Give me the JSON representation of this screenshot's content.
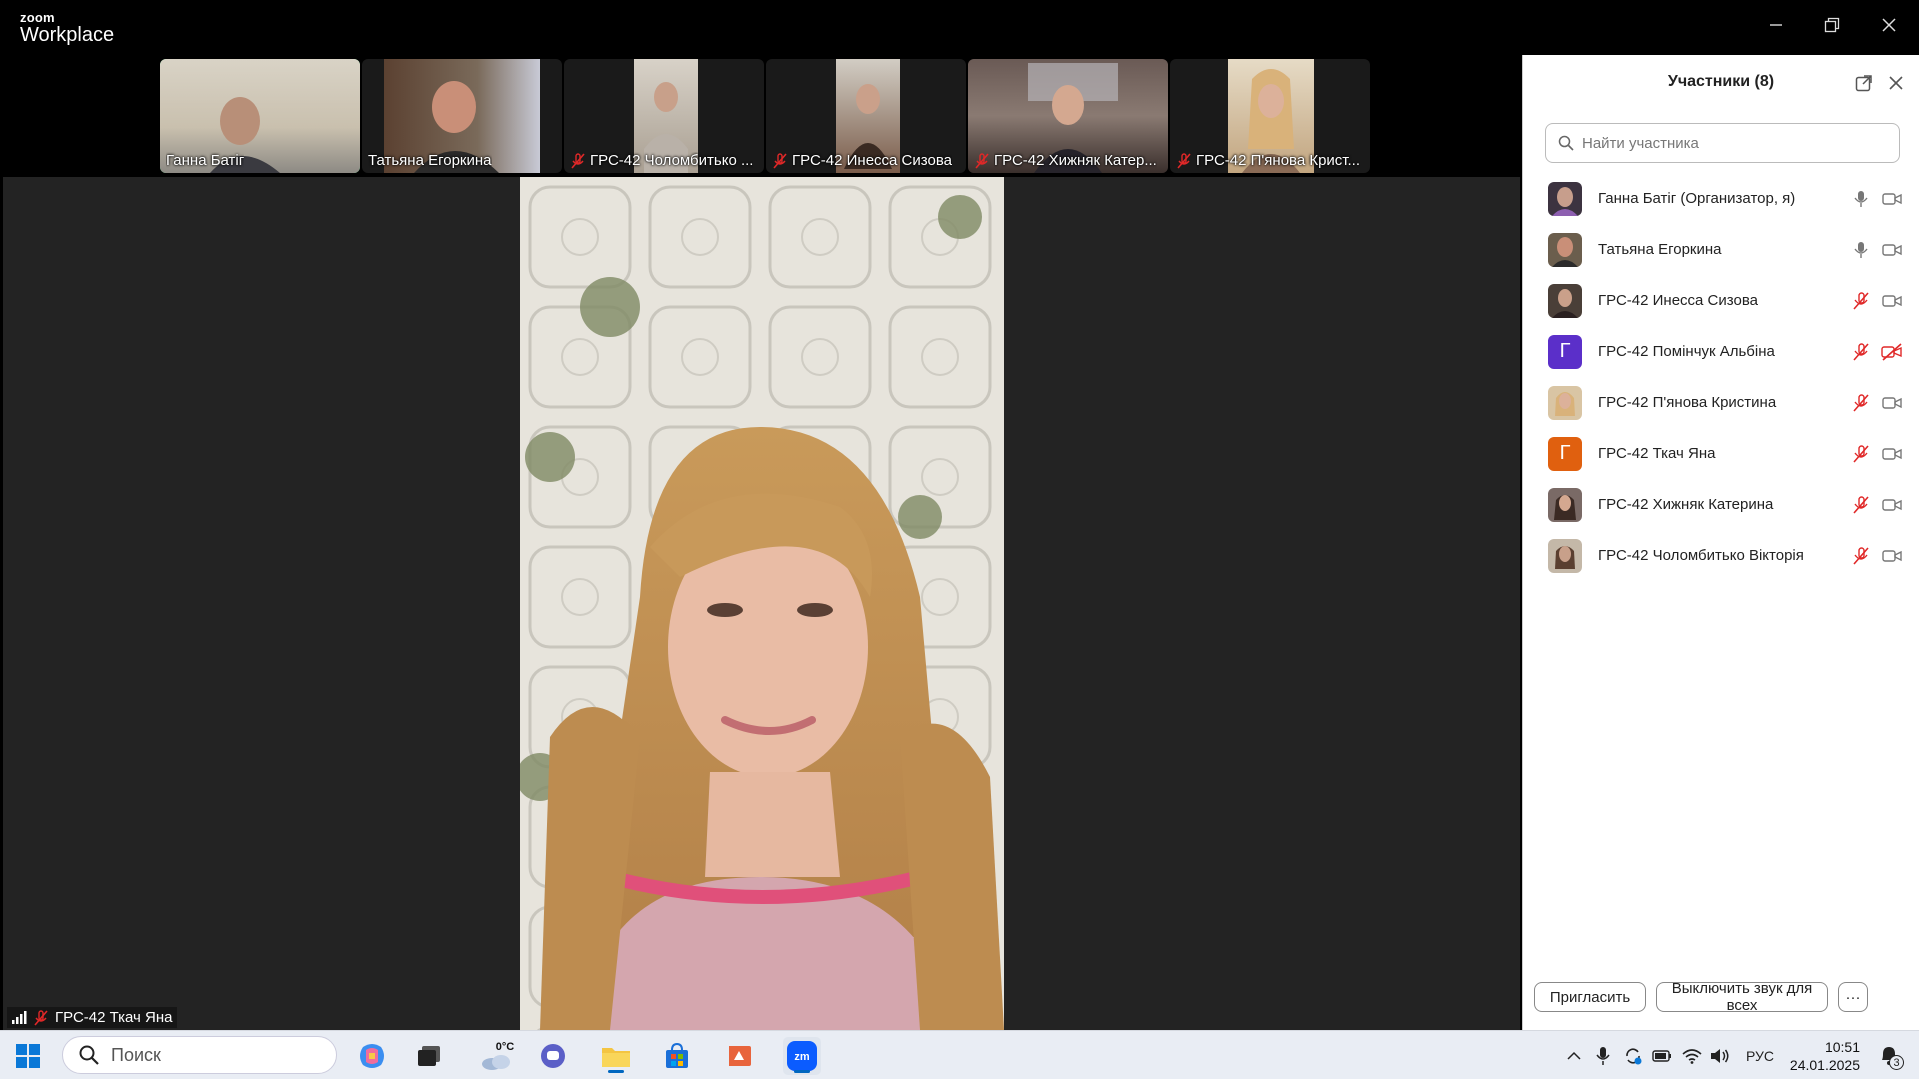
{
  "app": {
    "logo_line1": "zoom",
    "logo_line2": "Workplace"
  },
  "window_controls": [
    "minimize",
    "restore",
    "close"
  ],
  "strip": {
    "tiles": [
      {
        "name": "Ганна Батіг",
        "muted": false,
        "active": true
      },
      {
        "name": "Татьяна Егоркина",
        "muted": false,
        "active": false
      },
      {
        "name": "ГРС-42 Чоломбитько ...",
        "muted": true,
        "active": false
      },
      {
        "name": "ГРС-42 Инесса Сизова",
        "muted": true,
        "active": false
      },
      {
        "name": "ГРС-42 Хижняк Катер...",
        "muted": true,
        "active": false
      },
      {
        "name": "ГРС-42 П'янова Крист...",
        "muted": true,
        "active": false
      }
    ],
    "next_icon": "chevron-right-icon"
  },
  "stage": {
    "speaker_name": "ГРС-42 Ткач Яна"
  },
  "panel": {
    "title": "Участники (8)",
    "search_placeholder": "Найти участника",
    "participants": [
      {
        "name": "Ганна Батіг (Организатор, я)",
        "avatar": "photo",
        "mic": "on",
        "cam": "on"
      },
      {
        "name": "Татьяна Егоркина",
        "avatar": "photo",
        "mic": "on",
        "cam": "on"
      },
      {
        "name": "ГРС-42 Инесса Сизова",
        "avatar": "photo",
        "mic": "muted",
        "cam": "on"
      },
      {
        "name": "ГРС-42 Помінчук Альбіна",
        "avatar": "Г",
        "avatar_color": "#5b2fc9",
        "mic": "muted",
        "cam": "off"
      },
      {
        "name": "ГРС-42 П'янова Кристина",
        "avatar": "photo",
        "mic": "muted",
        "cam": "on"
      },
      {
        "name": "ГРС-42 Ткач Яна",
        "avatar": "Г",
        "avatar_color": "#e0600f",
        "mic": "muted",
        "cam": "on"
      },
      {
        "name": "ГРС-42 Хижняк Катерина",
        "avatar": "photo",
        "mic": "muted",
        "cam": "on"
      },
      {
        "name": "ГРС-42 Чоломбитько Вікторія",
        "avatar": "photo",
        "mic": "muted",
        "cam": "on"
      }
    ],
    "invite_label": "Пригласить",
    "mute_all_label": "Выключить звук для всех",
    "more_label": "···"
  },
  "taskbar": {
    "search_placeholder": "Поиск",
    "weather": "0°C",
    "language": "РУС",
    "time": "10:51",
    "date": "24.01.2025",
    "notification_count": "3",
    "colors": {
      "accent": "#0067c0"
    }
  },
  "colors": {
    "active_speaker": "#2ee07c",
    "muted_red": "#e02828",
    "zoom_blue": "#0e72ed"
  }
}
